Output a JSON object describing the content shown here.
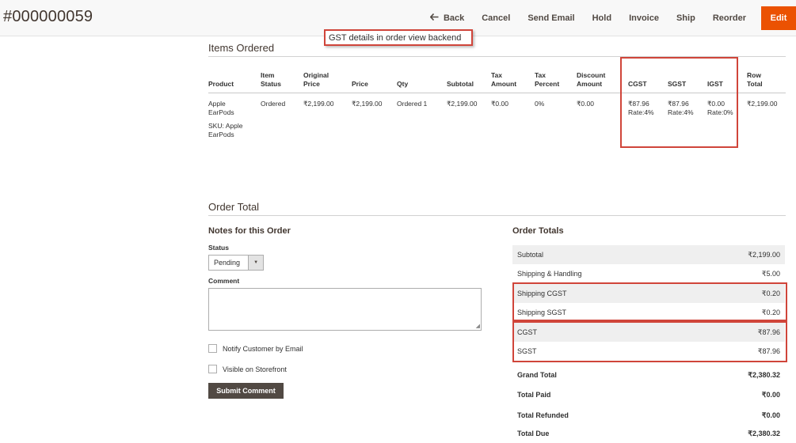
{
  "header": {
    "order_id": "#000000059",
    "actions": {
      "back": "Back",
      "cancel": "Cancel",
      "send_email": "Send Email",
      "hold": "Hold",
      "invoice": "Invoice",
      "ship": "Ship",
      "reorder": "Reorder",
      "edit": "Edit"
    }
  },
  "annotation": "GST details in order view backend",
  "items_ordered": {
    "title": "Items Ordered",
    "columns": {
      "product": "Product",
      "item_status_1": "Item",
      "item_status_2": "Status",
      "original_price_1": "Original",
      "original_price_2": "Price",
      "price": "Price",
      "qty": "Qty",
      "subtotal": "Subtotal",
      "tax_amount_1": "Tax",
      "tax_amount_2": "Amount",
      "tax_percent_1": "Tax",
      "tax_percent_2": "Percent",
      "discount_amount_1": "Discount",
      "discount_amount_2": "Amount",
      "cgst": "CGST",
      "sgst": "SGST",
      "igst": "IGST",
      "row_total_1": "Row",
      "row_total_2": "Total"
    },
    "row": {
      "product_1": "Apple",
      "product_2": "EarPods",
      "sku_1": "SKU: Apple",
      "sku_2": "EarPods",
      "item_status": "Ordered",
      "original_price": "₹2,199.00",
      "price": "₹2,199.00",
      "qty": "Ordered 1",
      "subtotal": "₹2,199.00",
      "tax_amount": "₹0.00",
      "tax_percent": "0%",
      "discount_amount": "₹0.00",
      "cgst_amount": "₹87.96",
      "cgst_rate": "Rate:4%",
      "sgst_amount": "₹87.96",
      "sgst_rate": "Rate:4%",
      "igst_amount": "₹0.00",
      "igst_rate": "Rate:0%",
      "row_total": "₹2,199.00"
    }
  },
  "order_total": {
    "title": "Order Total",
    "notes": {
      "title": "Notes for this Order",
      "status_label": "Status",
      "status_value": "Pending",
      "comment_label": "Comment",
      "notify_label": "Notify Customer by Email",
      "visible_label": "Visible on Storefront",
      "submit": "Submit Comment"
    },
    "totals": {
      "title": "Order Totals",
      "rows": [
        {
          "label": "Subtotal",
          "value": "₹2,199.00"
        },
        {
          "label": "Shipping & Handling",
          "value": "₹5.00"
        },
        {
          "label": "Shipping CGST",
          "value": "₹0.20"
        },
        {
          "label": "Shipping SGST",
          "value": "₹0.20"
        },
        {
          "label": "CGST",
          "value": "₹87.96"
        },
        {
          "label": "SGST",
          "value": "₹87.96"
        },
        {
          "label": "Grand Total",
          "value": "₹2,380.32"
        },
        {
          "label": "Total Paid",
          "value": "₹0.00"
        },
        {
          "label": "Total Refunded",
          "value": "₹0.00"
        },
        {
          "label": "Total Due",
          "value": "₹2,380.32"
        }
      ]
    }
  },
  "colors": {
    "accent": "#eb5202",
    "highlight_border": "#d0453a",
    "dark_button": "#514943"
  }
}
